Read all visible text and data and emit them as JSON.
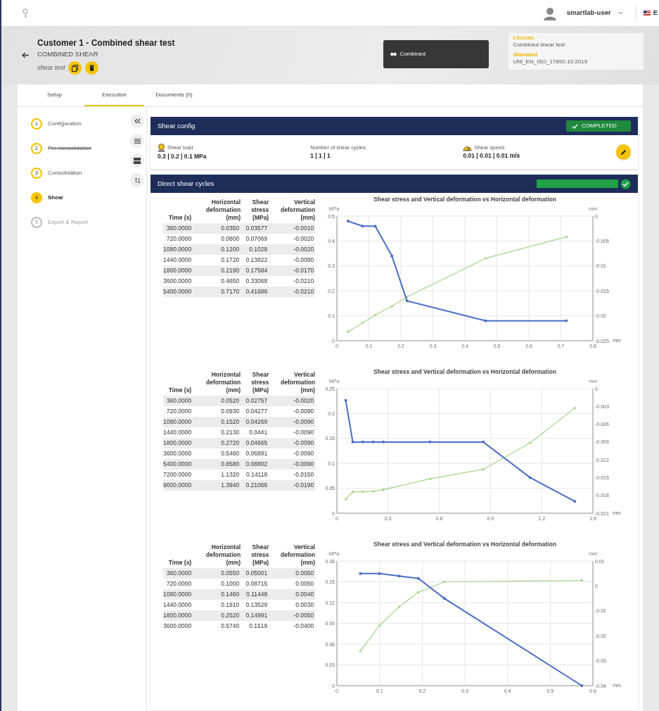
{
  "top_bar": {
    "user": "smartlab-user",
    "language": "E"
  },
  "header": {
    "title": "Customer 1 - Combined shear test",
    "subtitle": "COMBINED SHEAR",
    "note": "shear test",
    "mode": "Combined",
    "license_label": "License",
    "license": "Combined shear test",
    "standard_label": "Standard",
    "standard": "UNI_EN_ISO_17892-10:2019"
  },
  "tabs": [
    {
      "label": "Setup",
      "selected": false
    },
    {
      "label": "Execution",
      "selected": true
    },
    {
      "label": "Documents (0)",
      "selected": false
    }
  ],
  "steps": [
    {
      "number": "1",
      "label": "Configuration",
      "selected": false,
      "skipped": false,
      "disabled": false
    },
    {
      "number": "2",
      "label": "Pre-consolidation",
      "selected": false,
      "skipped": true,
      "disabled": false
    },
    {
      "number": "3",
      "label": "Consolidation",
      "selected": false,
      "skipped": false,
      "disabled": false
    },
    {
      "number": "4",
      "label": "Shear",
      "selected": true,
      "skipped": false,
      "disabled": false
    },
    {
      "number": "5",
      "label": "Export & Report",
      "selected": false,
      "skipped": false,
      "disabled": true
    }
  ],
  "shear_config": {
    "title": "Shear config",
    "status": "COMPLETED",
    "fields": [
      {
        "kind": "load",
        "label": "Shear load",
        "value": "0.3 | 0.2 | 0.1 MPa"
      },
      {
        "kind": "plain",
        "label": "Number of shear cycles",
        "value": "1 | 1 | 1"
      },
      {
        "kind": "speed",
        "label": "Shear speed",
        "value": "0.01 | 0.01 | 0.01 m/s"
      }
    ]
  },
  "cycles": {
    "title": "Direct shear cycles",
    "level": 1,
    "complete": true,
    "tests": [
      {
        "columns": [
          "Time (s)",
          "Horizontal deformation (mm)",
          "Shear stress (MPa)",
          "Vertical deformation (mm)"
        ],
        "rows": [
          [
            "360.0000",
            "0.0350",
            "0.03577",
            "-0.0010"
          ],
          [
            "720.0000",
            "0.0800",
            "0.07069",
            "-0.0020"
          ],
          [
            "1080.0000",
            "0.1200",
            "0.1028",
            "-0.0020"
          ],
          [
            "1440.0000",
            "0.1720",
            "0.13822",
            "-0.0080"
          ],
          [
            "1800.0000",
            "0.2190",
            "0.17584",
            "-0.0170"
          ],
          [
            "3600.0000",
            "0.4650",
            "0.33068",
            "-0.0210"
          ],
          [
            "5400.0000",
            "0.7170",
            "0.41686",
            "-0.0210"
          ]
        ],
        "chart_data": {
          "type": "line",
          "title": "Shear stress and Vertical deformation vs Horizontal deformation",
          "xlabel": "mm",
          "ylabel": "MPa",
          "y2label": "mm",
          "grid": true,
          "x": [
            0.035,
            0.08,
            0.12,
            0.172,
            0.219,
            0.465,
            0.717
          ],
          "xlim": [
            0,
            0.8
          ],
          "xticks": [
            0,
            0.1,
            0.2,
            0.3,
            0.4,
            0.5,
            0.6,
            0.7,
            0.8
          ],
          "ylim": [
            0,
            0.5
          ],
          "yticks": [
            0,
            0.1,
            0.2,
            0.3,
            0.4,
            0.5
          ],
          "y2lim": [
            -0.025,
            0
          ],
          "y2ticks": [
            0,
            -0.005,
            -0.01,
            -0.015,
            -0.02,
            -0.025
          ],
          "series": [
            {
              "color": "#a5d38a",
              "values": [
                0.036,
                0.071,
                0.103,
                0.138,
                0.176,
                0.331,
                0.417
              ]
            },
            {
              "axis": "y2",
              "color": "#4a6cc6",
              "values": [
                -0.001,
                -0.002,
                -0.002,
                -0.008,
                -0.017,
                -0.021,
                -0.021
              ]
            }
          ]
        }
      },
      {
        "columns": [
          "Time (s)",
          "Horizontal deformation (mm)",
          "Shear stress (MPa)",
          "Vertical deformation (mm)"
        ],
        "rows": [
          [
            "360.0000",
            "0.0520",
            "0.02757",
            "-0.0020"
          ],
          [
            "720.0000",
            "0.0930",
            "0.04277",
            "-0.0090"
          ],
          [
            "1080.0000",
            "0.1520",
            "0.04269",
            "-0.0090"
          ],
          [
            "1440.0000",
            "0.2130",
            "0.0441",
            "-0.0090"
          ],
          [
            "1800.0000",
            "0.2720",
            "0.04665",
            "-0.0090"
          ],
          [
            "3600.0000",
            "0.5460",
            "0.06891",
            "-0.0090"
          ],
          [
            "5400.0000",
            "0.8580",
            "0.08802",
            "-0.0090"
          ],
          [
            "7200.0000",
            "1.1320",
            "0.14118",
            "-0.0150"
          ],
          [
            "9000.0000",
            "1.3940",
            "0.21066",
            "-0.0190"
          ]
        ],
        "chart_data": {
          "type": "line",
          "title": "Shear stress and Vertical deformation vs Horizontal deformation",
          "xlabel": "mm",
          "ylabel": "MPa",
          "y2label": "mm",
          "grid": true,
          "x": [
            0.052,
            0.093,
            0.152,
            0.213,
            0.272,
            0.546,
            0.858,
            1.132,
            1.394
          ],
          "xlim": [
            0,
            1.5
          ],
          "xticks": [
            0,
            0.3,
            0.6,
            0.9,
            1.2,
            1.5
          ],
          "ylim": [
            0,
            0.25
          ],
          "yticks": [
            0,
            0.05,
            0.1,
            0.15,
            0.2,
            0.25
          ],
          "y2lim": [
            -0.021,
            0
          ],
          "y2ticks": [
            0,
            -0.003,
            -0.006,
            -0.009,
            -0.012,
            -0.015,
            -0.018,
            -0.021
          ],
          "series": [
            {
              "color": "#a5d38a",
              "values": [
                0.028,
                0.043,
                0.043,
                0.044,
                0.047,
                0.069,
                0.088,
                0.141,
                0.211
              ]
            },
            {
              "axis": "y2",
              "color": "#4a6cc6",
              "values": [
                -0.002,
                -0.009,
                -0.009,
                -0.009,
                -0.009,
                -0.009,
                -0.009,
                -0.015,
                -0.019
              ]
            }
          ]
        }
      },
      {
        "columns": [
          "Time (s)",
          "Horizontal deformation (mm)",
          "Shear stress (MPa)",
          "Vertical deformation (mm)"
        ],
        "rows": [
          [
            "360.0000",
            "0.0550",
            "0.05001",
            "0.0050"
          ],
          [
            "720.0000",
            "0.1000",
            "0.08715",
            "0.0050"
          ],
          [
            "1080.0000",
            "0.1460",
            "0.11448",
            "0.0040"
          ],
          [
            "1440.0000",
            "0.1910",
            "0.13529",
            "0.0030"
          ],
          [
            "1800.0000",
            "0.2520",
            "0.14991",
            "-0.0050"
          ],
          [
            "3600.0000",
            "0.5740",
            "0.1519",
            "-0.0400"
          ]
        ],
        "chart_data": {
          "type": "line",
          "title": "Shear stress and Vertical deformation vs Horizontal deformation",
          "xlabel": "mm",
          "ylabel": "MPa",
          "y2label": "mm",
          "grid": true,
          "x": [
            0.055,
            0.1,
            0.146,
            0.191,
            0.252,
            0.574
          ],
          "xlim": [
            0,
            0.6
          ],
          "xticks": [
            0,
            0.1,
            0.2,
            0.3,
            0.4,
            0.5,
            0.6
          ],
          "ylim": [
            0,
            0.18
          ],
          "yticks": [
            0,
            0.03,
            0.06,
            0.09,
            0.12,
            0.15,
            0.18
          ],
          "y2lim": [
            -0.04,
            0.01
          ],
          "y2ticks": [
            0.01,
            0,
            -0.01,
            -0.02,
            -0.03,
            -0.04
          ],
          "series": [
            {
              "color": "#a5d38a",
              "values": [
                0.05,
                0.087,
                0.114,
                0.135,
                0.15,
                0.152
              ]
            },
            {
              "axis": "y2",
              "color": "#4a6cc6",
              "values": [
                0.005,
                0.005,
                0.004,
                0.003,
                -0.005,
                -0.04
              ]
            }
          ]
        }
      }
    ]
  }
}
